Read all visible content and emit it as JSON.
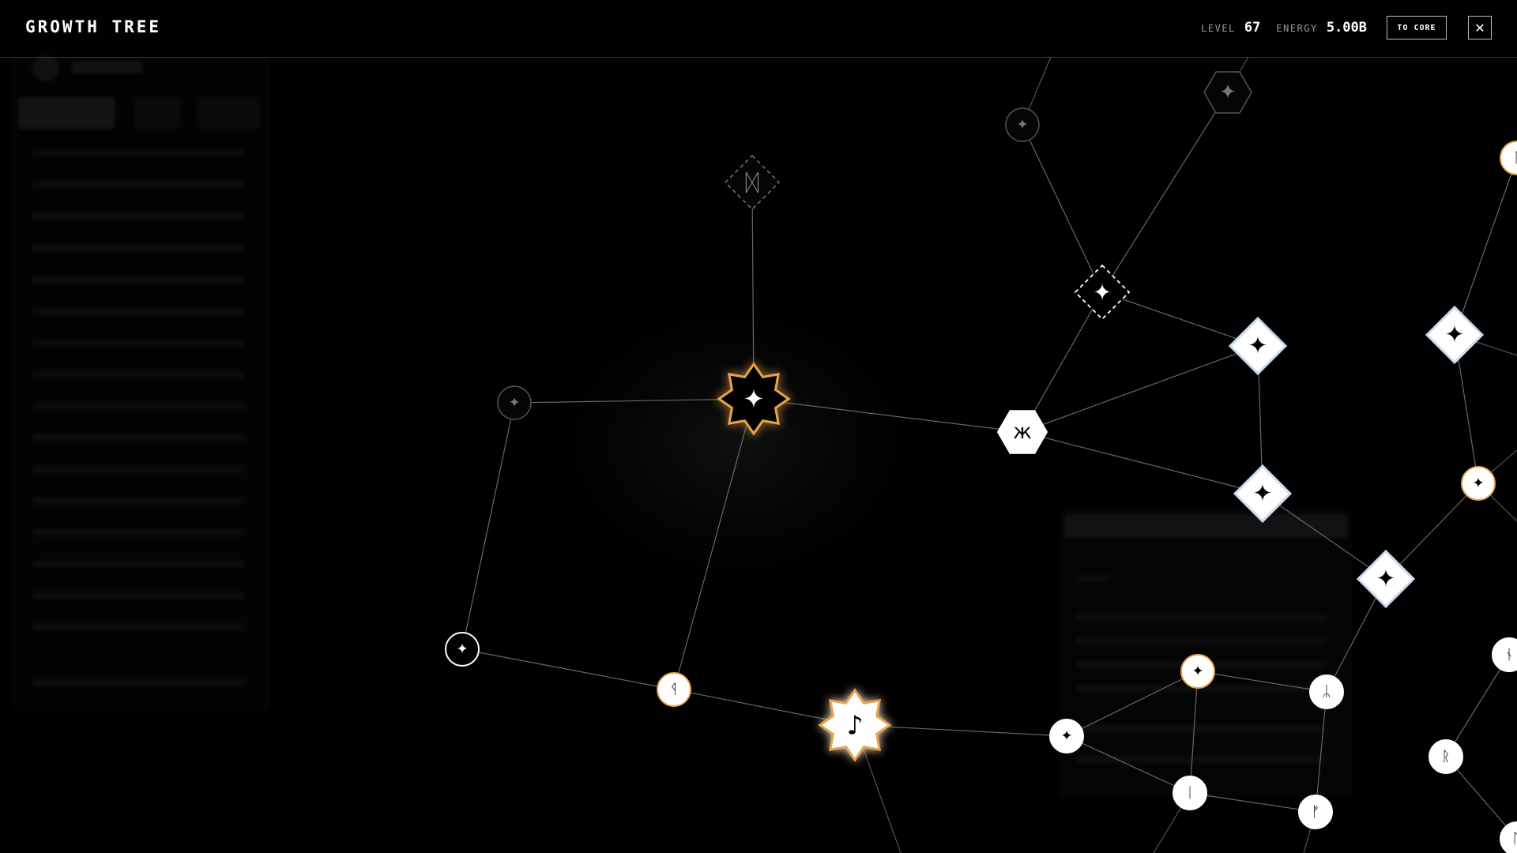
{
  "header": {
    "title": "GROWTH TREE",
    "level_label": "LEVEL",
    "level_value": "67",
    "energy_label": "ENERGY",
    "energy_value": "5.00B",
    "to_core_label": "TO CORE",
    "close_icon": "close-icon"
  },
  "colors": {
    "background": "#000000",
    "accent_gold": "#e8a550",
    "node_fill": "#ffffff",
    "node_dim": "#555555",
    "diamond_border": "#c9d9ee",
    "edge": "#8a8a8a"
  },
  "tree": {
    "nodes": [
      {
        "id": "n-hex-top",
        "shape": "hexagon",
        "state": "dim",
        "glyph": "✦"
      },
      {
        "id": "n-circle-top",
        "shape": "circle",
        "state": "dim",
        "glyph": "✦"
      },
      {
        "id": "n-diamond-dashed-left",
        "shape": "diamond",
        "state": "locked",
        "glyph": "ᛞ"
      },
      {
        "id": "n-diamond-dashed-right",
        "shape": "diamond",
        "state": "locked-bright",
        "glyph": "✦"
      },
      {
        "id": "n-circle-left",
        "shape": "circle",
        "state": "dim",
        "glyph": "✦"
      },
      {
        "id": "n-star-core",
        "shape": "star",
        "state": "active-dark",
        "glyph": "✦"
      },
      {
        "id": "n-hex-mid",
        "shape": "hexagon",
        "state": "unlocked",
        "glyph": "ж"
      },
      {
        "id": "n-diamond-1",
        "shape": "diamond",
        "state": "unlocked",
        "glyph": "✦"
      },
      {
        "id": "n-diamond-2",
        "shape": "diamond",
        "state": "unlocked",
        "glyph": "✦"
      },
      {
        "id": "n-diamond-3",
        "shape": "diamond",
        "state": "unlocked",
        "glyph": "✦"
      },
      {
        "id": "n-diamond-4",
        "shape": "diamond",
        "state": "unlocked",
        "glyph": "✦"
      },
      {
        "id": "n-circle-outline",
        "shape": "circle",
        "state": "outline",
        "glyph": "✦"
      },
      {
        "id": "n-circle-rune-1",
        "shape": "circle",
        "state": "gold",
        "glyph": "ᛩ"
      },
      {
        "id": "n-star-gold",
        "shape": "star",
        "state": "active-gold",
        "glyph": "♪"
      },
      {
        "id": "n-circle-a",
        "shape": "circle",
        "state": "unlocked",
        "glyph": "✦"
      },
      {
        "id": "n-circle-b",
        "shape": "circle",
        "state": "gold",
        "glyph": "✦"
      },
      {
        "id": "n-circle-c",
        "shape": "circle",
        "state": "unlocked",
        "glyph": "ᛦ"
      },
      {
        "id": "n-circle-d",
        "shape": "circle",
        "state": "unlocked",
        "glyph": "ᛁ"
      },
      {
        "id": "n-circle-e",
        "shape": "circle",
        "state": "unlocked",
        "glyph": "ᚠ"
      },
      {
        "id": "n-circle-f",
        "shape": "circle",
        "state": "gold",
        "glyph": "✦"
      },
      {
        "id": "n-circle-g",
        "shape": "circle",
        "state": "unlocked",
        "glyph": "ᚱ"
      },
      {
        "id": "n-circle-edge-1",
        "shape": "circle",
        "state": "gold",
        "glyph": "ᛚ"
      },
      {
        "id": "n-circle-edge-2",
        "shape": "circle",
        "state": "unlocked",
        "glyph": "ᚾ"
      },
      {
        "id": "n-circle-edge-3",
        "shape": "circle",
        "state": "unlocked",
        "glyph": "ᚢ"
      }
    ]
  }
}
